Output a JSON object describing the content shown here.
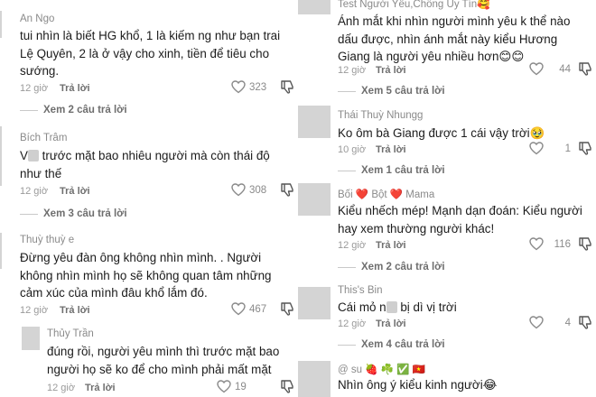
{
  "left": {
    "comments": [
      {
        "user": "An Ngo",
        "text": "tui nhìn là biết HG khổ, 1 là kiếm ng như bạn trai Lệ Quyên, 2 là ở vậy cho xinh, tiền để tiêu cho sướng.",
        "time": "12 giờ",
        "reply": "Trả lời",
        "likes": "323"
      },
      {
        "user": "Bích Trâm",
        "text_pre": "V",
        "text_post": " trước mặt bao nhiêu người mà còn thái độ như thế",
        "time": "12 giờ",
        "reply": "Trả lời",
        "likes": "308"
      },
      {
        "user": "Thuỳ thuỳ e",
        "text": "Đừng yêu đàn ông không nhìn mình. . Người không nhìn mình họ sẽ không quan tâm những cảm xúc của mình đâu khổ lắm đó.",
        "time": "12 giờ",
        "reply": "Trả lời",
        "likes": "467"
      },
      {
        "user": "Thủy Trần",
        "text": "đúng rồi, người yêu mình thì trước mặt bao người họ sẽ ko để cho mình phải mất mặt",
        "time": "12 giờ",
        "reply": "Trả lời",
        "likes": "19"
      }
    ],
    "more_replies": [
      "Xem 2 câu trả lời",
      "Xem 3 câu trả lời"
    ]
  },
  "right": {
    "comments": [
      {
        "user": "Test Người Yêu,Chồng Uy Tín",
        "user_emoji": "🥰",
        "text": "Ánh mắt khi nhìn người mình yêu k thể nào dấu được, nhìn ánh mắt này kiểu Hương Giang là người yêu nhiều hơn",
        "text_emoji": "😊😊",
        "time": "12 giờ",
        "reply": "Trả lời",
        "likes": "44"
      },
      {
        "user": "Thái Thuỳ Nhungg",
        "text": "Ko ôm bà Giang được 1 cái vậy trời",
        "text_emoji": "🥹",
        "time": "10 giờ",
        "reply": "Trả lời",
        "likes": "1"
      },
      {
        "user": "Bối ❤️ Bột ❤️ Mama",
        "text": "Kiểu nhếch mép! Mạnh dạn đoán: Kiểu người hay xem thường người khác!",
        "time": "12 giờ",
        "reply": "Trả lời",
        "likes": "116"
      },
      {
        "user": "This's Bin",
        "text_pre": "Cái mỏ n",
        "text_post": " bị dì vị trời",
        "time": "12 giờ",
        "reply": "Trả lời",
        "likes": "4"
      },
      {
        "user": "@ su 🍓 ☘️ ✅ 🇻🇳",
        "text": "Nhìn ông ý kiểu kinh người",
        "text_emoji": "😂"
      }
    ],
    "more_replies": [
      "Xem 5 câu trả lời",
      "Xem 1 câu trả lời",
      "Xem 2 câu trả lời",
      "Xem 4 câu trả lời"
    ]
  }
}
